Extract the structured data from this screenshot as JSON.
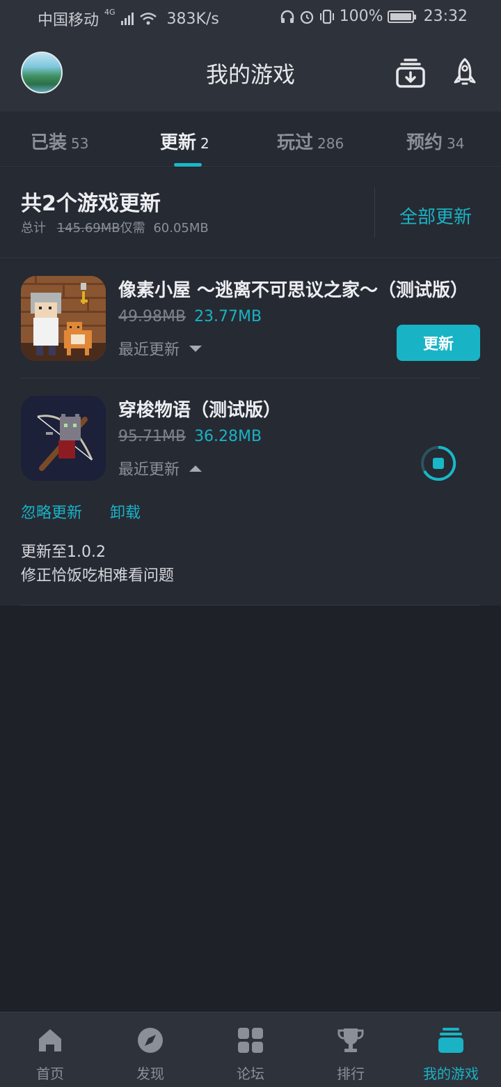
{
  "status": {
    "carrier": "中国移动",
    "network": "4G",
    "speed": "383K/s",
    "battery": "100%",
    "time": "23:32"
  },
  "header": {
    "title": "我的游戏",
    "download_icon": "download-tray-icon",
    "rocket_icon": "rocket-icon"
  },
  "tabs": [
    {
      "label": "已装",
      "count": "53",
      "active": false
    },
    {
      "label": "更新",
      "count": "2",
      "active": true
    },
    {
      "label": "玩过",
      "count": "286",
      "active": false
    },
    {
      "label": "预约",
      "count": "34",
      "active": false
    }
  ],
  "summary": {
    "title": "共2个游戏更新",
    "total_prefix": "总计",
    "total_old": "145.69MB",
    "total_mid": "仅需",
    "total_new": "60.05MB",
    "update_all": "全部更新"
  },
  "games": [
    {
      "name": "像素小屋 ～逃离不可思议之家～（测试版）",
      "old_size": "49.98MB",
      "new_size": "23.77MB",
      "recent": "最近更新",
      "button": "更新"
    },
    {
      "name": "穿梭物语（测试版）",
      "old_size": "95.71MB",
      "new_size": "36.28MB",
      "recent": "最近更新",
      "actions": [
        "忽略更新",
        "卸载"
      ],
      "notes_line1": "更新至1.0.2",
      "notes_line2": "修正恰饭吃相难看问题"
    }
  ],
  "nav": [
    {
      "label": "首页",
      "icon": "home-icon"
    },
    {
      "label": "发现",
      "icon": "compass-icon"
    },
    {
      "label": "论坛",
      "icon": "grid-icon"
    },
    {
      "label": "排行",
      "icon": "trophy-icon"
    },
    {
      "label": "我的游戏",
      "icon": "game-library-icon",
      "active": true
    }
  ],
  "colors": {
    "accent": "#18b8c8",
    "background": "#1f2129",
    "panel": "#262a33",
    "bar": "#2e323b"
  }
}
